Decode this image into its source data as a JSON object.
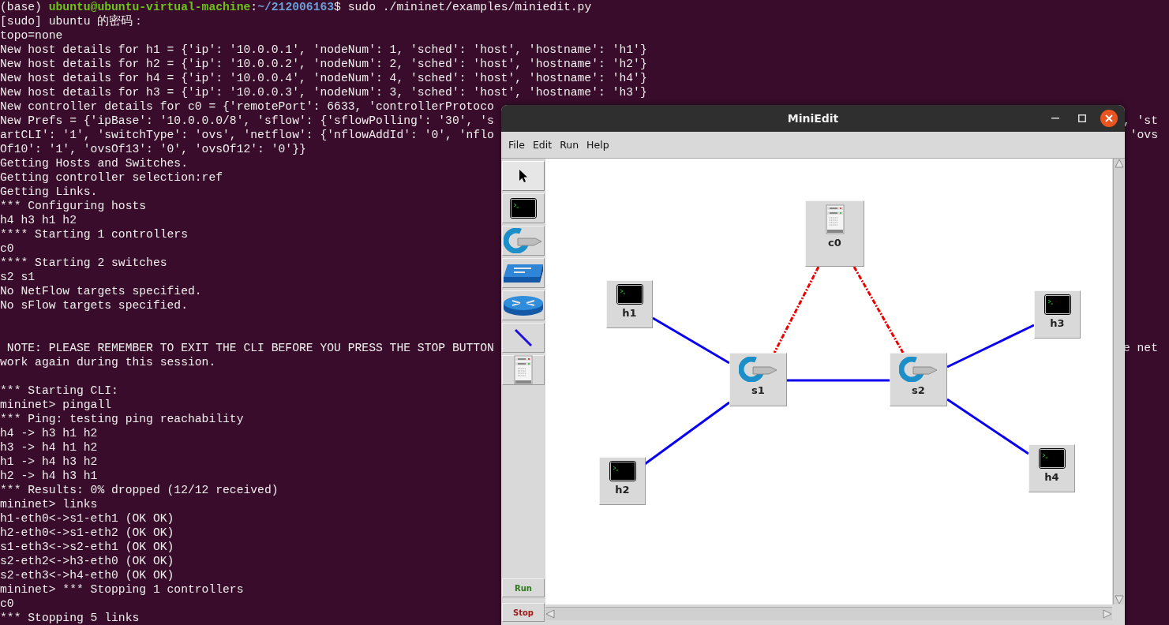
{
  "terminal": {
    "prompt": [
      {
        "kind": "plain",
        "text": "(base) "
      },
      {
        "kind": "user",
        "text": "ubuntu@ubuntu-virtual-machine"
      },
      {
        "kind": "plain",
        "text": ":"
      },
      {
        "kind": "path",
        "text": "~/212006163"
      },
      {
        "kind": "plain",
        "text": "$ sudo ./mininet/examples/miniedit.py"
      }
    ],
    "lines": [
      {
        "kind": "text",
        "text": "[sudo] ubuntu 的密码："
      },
      {
        "kind": "text",
        "text": "topo=none"
      },
      {
        "kind": "text",
        "text": "New host details for h1 = {'ip': '10.0.0.1', 'nodeNum': 1, 'sched': 'host', 'hostname': 'h1'}"
      },
      {
        "kind": "text",
        "text": "New host details for h2 = {'ip': '10.0.0.2', 'nodeNum': 2, 'sched': 'host', 'hostname': 'h2'}"
      },
      {
        "kind": "text",
        "text": "New host details for h4 = {'ip': '10.0.0.4', 'nodeNum': 4, 'sched': 'host', 'hostname': 'h4'}"
      },
      {
        "kind": "text",
        "text": "New host details for h3 = {'ip': '10.0.0.3', 'nodeNum': 3, 'sched': 'host', 'hostname': 'h3'}"
      },
      {
        "kind": "text",
        "text": "New controller details for c0 = {'remotePort': 6633, 'controllerProtoco"
      },
      {
        "kind": "text",
        "text": "New Prefs = {'ipBase': '10.0.0.0/8', 'sflow': {'sflowPolling': '30', 's",
        "right": ", 'st"
      },
      {
        "kind": "text",
        "text": "artCLI': '1', 'switchType': 'ovs', 'netflow': {'nflowAddId': '0', 'nflo",
        "right": "'ovs"
      },
      {
        "kind": "text",
        "text": "Of10': '1', 'ovsOf13': '0', 'ovsOf12': '0'}}"
      },
      {
        "kind": "text",
        "text": "Getting Hosts and Switches."
      },
      {
        "kind": "text",
        "text": "Getting controller selection:ref"
      },
      {
        "kind": "text",
        "text": "Getting Links."
      },
      {
        "kind": "text",
        "text": "*** Configuring hosts"
      },
      {
        "kind": "text",
        "text": "h4 h3 h1 h2"
      },
      {
        "kind": "text",
        "text": "**** Starting 1 controllers"
      },
      {
        "kind": "text",
        "text": "c0"
      },
      {
        "kind": "text",
        "text": "**** Starting 2 switches"
      },
      {
        "kind": "text",
        "text": "s2 s1"
      },
      {
        "kind": "text",
        "text": "No NetFlow targets specified."
      },
      {
        "kind": "text",
        "text": "No sFlow targets specified."
      },
      {
        "kind": "blank"
      },
      {
        "kind": "blank"
      },
      {
        "kind": "text",
        "text": " NOTE: PLEASE REMEMBER TO EXIT THE CLI BEFORE YOU PRESS THE STOP BUTTON",
        "right": "e net"
      },
      {
        "kind": "text",
        "text": "work again during this session."
      },
      {
        "kind": "blank"
      },
      {
        "kind": "text",
        "text": "*** Starting CLI:"
      },
      {
        "kind": "text",
        "text": "mininet> pingall"
      },
      {
        "kind": "text",
        "text": "*** Ping: testing ping reachability"
      },
      {
        "kind": "text",
        "text": "h4 -> h3 h1 h2"
      },
      {
        "kind": "text",
        "text": "h3 -> h4 h1 h2"
      },
      {
        "kind": "text",
        "text": "h1 -> h4 h3 h2"
      },
      {
        "kind": "text",
        "text": "h2 -> h4 h3 h1"
      },
      {
        "kind": "text",
        "text": "*** Results: 0% dropped (12/12 received)"
      },
      {
        "kind": "text",
        "text": "mininet> links"
      },
      {
        "kind": "text",
        "text": "h1-eth0<->s1-eth1 (OK OK)"
      },
      {
        "kind": "text",
        "text": "h2-eth0<->s1-eth2 (OK OK)"
      },
      {
        "kind": "text",
        "text": "s1-eth3<->s2-eth1 (OK OK)"
      },
      {
        "kind": "text",
        "text": "s2-eth2<->h3-eth0 (OK OK)"
      },
      {
        "kind": "text",
        "text": "s2-eth3<->h4-eth0 (OK OK)"
      },
      {
        "kind": "text",
        "text": "mininet> *** Stopping 1 controllers"
      },
      {
        "kind": "text",
        "text": "c0"
      },
      {
        "kind": "text",
        "text": "*** Stopping 5 links"
      }
    ]
  },
  "window": {
    "title": "MiniEdit",
    "menu": [
      "File",
      "Edit",
      "Run",
      "Help"
    ],
    "tools": [
      {
        "kind": "select",
        "selected": true
      },
      {
        "kind": "host",
        "selected": false
      },
      {
        "kind": "switch",
        "selected": false
      },
      {
        "kind": "legacy-switch",
        "selected": false
      },
      {
        "kind": "router",
        "selected": false
      },
      {
        "kind": "link",
        "selected": false
      },
      {
        "kind": "controller",
        "selected": false
      }
    ],
    "run_buttons": [
      {
        "kind": "run",
        "label": "Run"
      },
      {
        "kind": "stop",
        "label": "Stop"
      }
    ],
    "nodes": [
      {
        "kind": "controller",
        "label": "c0"
      },
      {
        "kind": "host",
        "label": "h1"
      },
      {
        "kind": "host",
        "label": "h3"
      },
      {
        "kind": "switch",
        "label": "s1"
      },
      {
        "kind": "switch",
        "label": "s2"
      },
      {
        "kind": "host",
        "label": "h2"
      },
      {
        "kind": "host",
        "label": "h4"
      }
    ],
    "links": [
      {
        "kind": "data"
      },
      {
        "kind": "data"
      },
      {
        "kind": "data"
      },
      {
        "kind": "data"
      },
      {
        "kind": "data"
      },
      {
        "kind": "control"
      },
      {
        "kind": "control"
      }
    ]
  }
}
